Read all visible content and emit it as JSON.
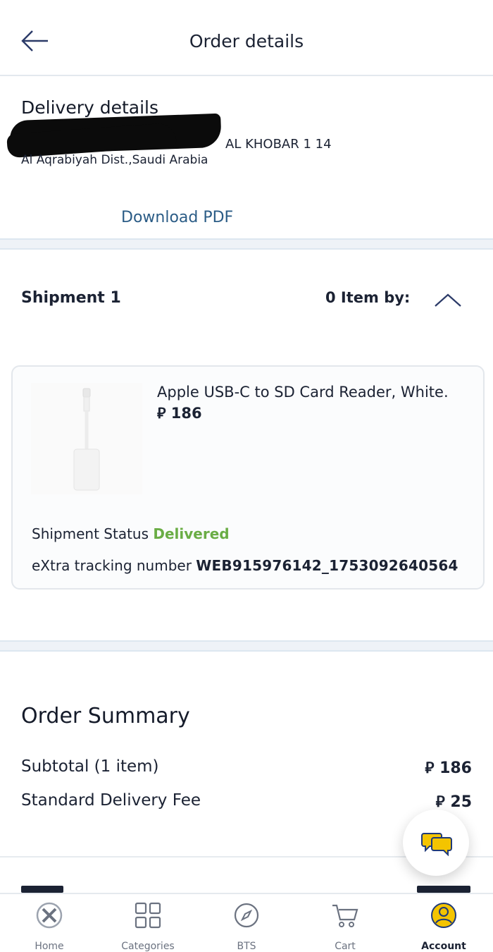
{
  "header": {
    "title": "Order details"
  },
  "delivery": {
    "title": "Delivery details",
    "address_line1": "AL KHOBAR 1 14",
    "address_line2": "Al Aqrabiyah Dist.,Saudi Arabia",
    "download_label": "Download PDF"
  },
  "shipment": {
    "title": "Shipment 1",
    "items_label": "0  Item by:",
    "product": {
      "name": "Apple USB-C to SD Card Reader, White.",
      "price": "⃁ 186"
    },
    "status_label": "Shipment Status",
    "status_value": "Delivered",
    "tracking_label": "eXtra tracking number",
    "tracking_value": "WEB915976142_1753092640564"
  },
  "summary": {
    "title": "Order Summary",
    "rows": [
      {
        "label": "Subtotal (1 item)",
        "value": "⃁ 186"
      },
      {
        "label": "Standard Delivery Fee",
        "value": "⃁ 25"
      }
    ]
  },
  "bottom_nav": {
    "items": [
      {
        "label": "Home",
        "icon": "home-x-icon"
      },
      {
        "label": "Categories",
        "icon": "grid-icon"
      },
      {
        "label": "BTS",
        "icon": "compass-icon"
      },
      {
        "label": "Cart",
        "icon": "cart-icon"
      },
      {
        "label": "Account",
        "icon": "account-icon",
        "active": true
      }
    ]
  },
  "colors": {
    "accent_link": "#2b5c86",
    "delivered": "#6aad45",
    "chat_yellow": "#f4c400",
    "active_nav": "#f4c400"
  }
}
